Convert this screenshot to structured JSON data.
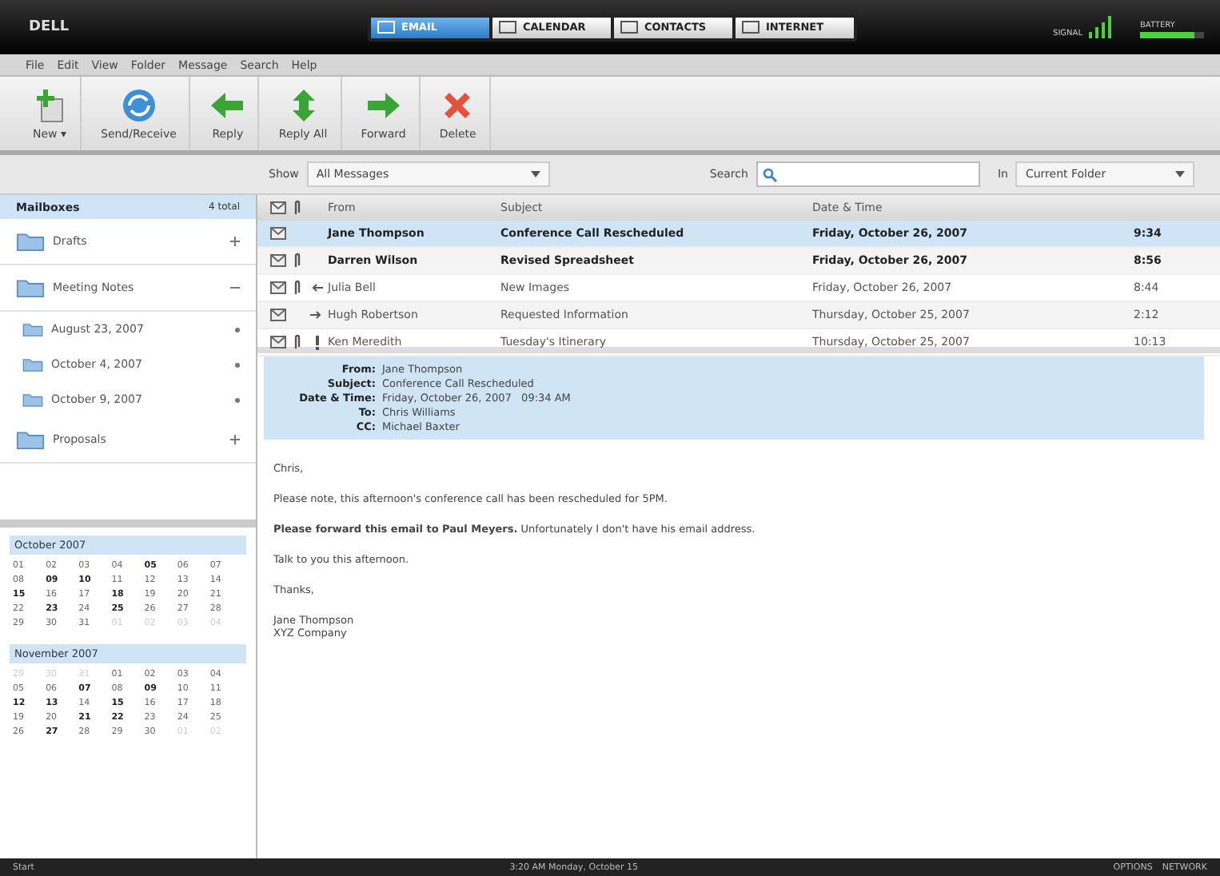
{
  "top_bar": {
    "logo": "DELL",
    "tabs": [
      {
        "label": "EMAIL",
        "selected": true
      },
      {
        "label": "CALENDAR",
        "selected": false
      },
      {
        "label": "CONTACTS",
        "selected": false
      },
      {
        "label": "INTERNET",
        "selected": false
      }
    ],
    "signal_label": "SIGNAL",
    "battery_label": "BATTERY",
    "battery": {
      "level": 0.85
    }
  },
  "menu": [
    "File",
    "Edit",
    "View",
    "Folder",
    "Message",
    "Search",
    "Help"
  ],
  "toolbar": [
    {
      "label": "New ▾",
      "kind": "new"
    },
    {
      "label": "Send/Receive",
      "kind": "sync"
    },
    {
      "label": "Reply",
      "kind": "reply"
    },
    {
      "label": "Reply All",
      "kind": "replyall"
    },
    {
      "label": "Forward",
      "kind": "forward"
    },
    {
      "label": "Delete",
      "kind": "delete"
    }
  ],
  "filter": {
    "show_label": "Show",
    "show_value": "All Messages",
    "search_label": "Search",
    "in_label": "In",
    "in_value": "Current Folder"
  },
  "mailboxes": {
    "title": "Mailboxes",
    "count": "4 total",
    "folders": [
      {
        "name": "Drafts",
        "expanded": false
      },
      {
        "name": "Meeting Notes",
        "expanded": true,
        "children": [
          {
            "name": "August 23, 2007"
          },
          {
            "name": "October 4, 2007"
          },
          {
            "name": "October 9, 2007"
          }
        ]
      },
      {
        "name": "Proposals",
        "expanded": false
      }
    ]
  },
  "calendars": [
    {
      "title": "October 2007",
      "days": [
        {
          "d": "01",
          "bold": false,
          "muted": false
        },
        {
          "d": "02",
          "bold": false,
          "muted": false
        },
        {
          "d": "03",
          "bold": false,
          "muted": false
        },
        {
          "d": "04",
          "bold": false,
          "muted": false
        },
        {
          "d": "05",
          "bold": true,
          "muted": false
        },
        {
          "d": "06",
          "bold": false,
          "muted": false
        },
        {
          "d": "07",
          "bold": false,
          "muted": false
        },
        {
          "d": "08",
          "bold": false,
          "muted": false
        },
        {
          "d": "09",
          "bold": true,
          "muted": false
        },
        {
          "d": "10",
          "bold": true,
          "muted": false
        },
        {
          "d": "11",
          "bold": false,
          "muted": false
        },
        {
          "d": "12",
          "bold": false,
          "muted": false
        },
        {
          "d": "13",
          "bold": false,
          "muted": false
        },
        {
          "d": "14",
          "bold": false,
          "muted": false
        },
        {
          "d": "15",
          "bold": true,
          "muted": false
        },
        {
          "d": "16",
          "bold": false,
          "muted": false
        },
        {
          "d": "17",
          "bold": false,
          "muted": false
        },
        {
          "d": "18",
          "bold": true,
          "muted": false
        },
        {
          "d": "19",
          "bold": false,
          "muted": false
        },
        {
          "d": "20",
          "bold": false,
          "muted": false
        },
        {
          "d": "21",
          "bold": false,
          "muted": false
        },
        {
          "d": "22",
          "bold": false,
          "muted": false
        },
        {
          "d": "23",
          "bold": true,
          "muted": false
        },
        {
          "d": "24",
          "bold": false,
          "muted": false
        },
        {
          "d": "25",
          "bold": true,
          "muted": false
        },
        {
          "d": "26",
          "bold": false,
          "muted": false
        },
        {
          "d": "27",
          "bold": false,
          "muted": false
        },
        {
          "d": "28",
          "bold": false,
          "muted": false
        },
        {
          "d": "29",
          "bold": false,
          "muted": false
        },
        {
          "d": "30",
          "bold": false,
          "muted": false
        },
        {
          "d": "31",
          "bold": false,
          "muted": false
        },
        {
          "d": "01",
          "bold": false,
          "muted": true
        },
        {
          "d": "02",
          "bold": false,
          "muted": true
        },
        {
          "d": "03",
          "bold": false,
          "muted": true
        },
        {
          "d": "04",
          "bold": false,
          "muted": true
        }
      ]
    },
    {
      "title": "November 2007",
      "days": [
        {
          "d": "29",
          "bold": false,
          "muted": true
        },
        {
          "d": "30",
          "bold": false,
          "muted": true
        },
        {
          "d": "31",
          "bold": false,
          "muted": true
        },
        {
          "d": "01",
          "bold": false,
          "muted": false
        },
        {
          "d": "02",
          "bold": false,
          "muted": false
        },
        {
          "d": "03",
          "bold": false,
          "muted": false
        },
        {
          "d": "04",
          "bold": false,
          "muted": false
        },
        {
          "d": "05",
          "bold": false,
          "muted": false
        },
        {
          "d": "06",
          "bold": false,
          "muted": false
        },
        {
          "d": "07",
          "bold": true,
          "muted": false
        },
        {
          "d": "08",
          "bold": false,
          "muted": false
        },
        {
          "d": "09",
          "bold": true,
          "muted": false
        },
        {
          "d": "10",
          "bold": false,
          "muted": false
        },
        {
          "d": "11",
          "bold": false,
          "muted": false
        },
        {
          "d": "12",
          "bold": true,
          "muted": false
        },
        {
          "d": "13",
          "bold": true,
          "muted": false
        },
        {
          "d": "14",
          "bold": false,
          "muted": false
        },
        {
          "d": "15",
          "bold": true,
          "muted": false
        },
        {
          "d": "16",
          "bold": false,
          "muted": false
        },
        {
          "d": "17",
          "bold": false,
          "muted": false
        },
        {
          "d": "18",
          "bold": false,
          "muted": false
        },
        {
          "d": "19",
          "bold": false,
          "muted": false
        },
        {
          "d": "20",
          "bold": false,
          "muted": false
        },
        {
          "d": "21",
          "bold": true,
          "muted": false
        },
        {
          "d": "22",
          "bold": true,
          "muted": false
        },
        {
          "d": "23",
          "bold": false,
          "muted": false
        },
        {
          "d": "24",
          "bold": false,
          "muted": false
        },
        {
          "d": "25",
          "bold": false,
          "muted": false
        },
        {
          "d": "26",
          "bold": false,
          "muted": false
        },
        {
          "d": "27",
          "bold": true,
          "muted": false
        },
        {
          "d": "28",
          "bold": false,
          "muted": false
        },
        {
          "d": "29",
          "bold": false,
          "muted": false
        },
        {
          "d": "30",
          "bold": false,
          "muted": false
        },
        {
          "d": "01",
          "bold": false,
          "muted": true
        },
        {
          "d": "02",
          "bold": false,
          "muted": true
        }
      ]
    }
  ],
  "table": {
    "columns": [
      "From",
      "Subject",
      "Date & Time"
    ],
    "rows": [
      {
        "from": "Jane Thompson",
        "subject": "Conference Call Rescheduled",
        "date": "Friday, October 26, 2007",
        "time": "9:34",
        "unread": true,
        "selected": true,
        "attachment": false,
        "replied": false,
        "forwarded": false,
        "high_priority": false
      },
      {
        "from": "Darren Wilson",
        "subject": "Revised Spreadsheet",
        "date": "Friday, October 26, 2007",
        "time": "8:56",
        "unread": true,
        "selected": false,
        "attachment": true,
        "replied": false,
        "forwarded": false,
        "high_priority": false
      },
      {
        "from": "Julia Bell",
        "subject": "New Images",
        "date": "Friday, October 26, 2007",
        "time": "8:44",
        "unread": false,
        "selected": false,
        "attachment": true,
        "replied": true,
        "forwarded": false,
        "high_priority": false
      },
      {
        "from": "Hugh Robertson",
        "subject": "Requested Information",
        "date": "Thursday, October 25, 2007",
        "time": "2:12",
        "unread": false,
        "selected": false,
        "attachment": false,
        "replied": false,
        "forwarded": true,
        "high_priority": false
      },
      {
        "from": "Ken Meredith",
        "subject": "Tuesday's Itinerary",
        "date": "Thursday, October 25, 2007",
        "time": "10:13",
        "unread": false,
        "selected": false,
        "attachment": true,
        "replied": false,
        "forwarded": false,
        "high_priority": true
      }
    ]
  },
  "preview": {
    "fields": [
      {
        "label": "From:",
        "value": "Jane Thompson"
      },
      {
        "label": "Subject:",
        "value": "Conference Call Rescheduled"
      },
      {
        "label": "Date & Time:",
        "value": "Friday, October 26, 2007   09:34 AM"
      },
      {
        "label": "To:",
        "value": "Chris Williams"
      },
      {
        "label": "CC:",
        "value": "Michael Baxter"
      }
    ],
    "body": [
      "Chris,",
      "Please note, this afternoon's conference call has been rescheduled for 5PM.",
      "**Please forward this email to Paul Meyers.** Unfortunately I don't have his email address.",
      "Talk to you this afternoon.",
      "Thanks,"
    ],
    "signature": [
      "Jane Thompson",
      "XYZ Company"
    ]
  },
  "taskbar": {
    "start": "Start",
    "clock": "3:20 AM    Monday, October 15",
    "right": [
      "OPTIONS",
      "NETWORK"
    ]
  }
}
